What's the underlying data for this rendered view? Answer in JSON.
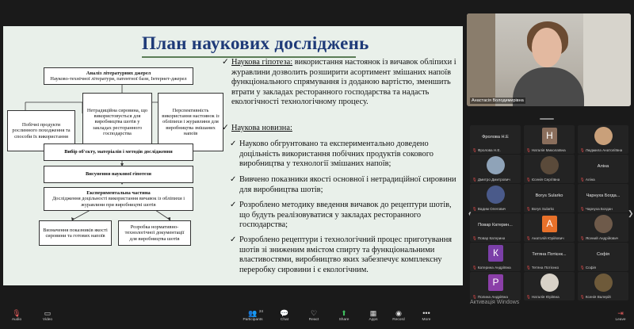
{
  "slide": {
    "title": "План наукових досліджень",
    "flow": {
      "box_top_title": "Аналіз літературних джерел",
      "box_top_sub": "Науково-технічної літератури, патентної бази, Інтернет-джерел",
      "box_l1": "Побічні продукти рослинного походження та способи їх використання",
      "box_l2": "Нетрадиційна сировина, що використовується для виробництва шотів у закладах ресторанного господарства",
      "box_l3": "Перспективність використання настоянок із обліпихи і журавлини для виробництва змішаних напоїв",
      "box_objects": "Вибір об'єкту, матеріалів і методів дослідження",
      "box_hypothesis": "Висунення наукової гіпотези",
      "box_exp_title": "Експериментальна частина",
      "box_exp_sub": "Дослідження доцільності використання вичавок із обліпихи і журавлини при виробництві шотів",
      "box_b1": "Визначення показників якості сировини та готових напоїв",
      "box_b2": "Розробка нормативно-технологічної документації для виробництва шотів"
    },
    "hypothesis_label": "Наукова гіпотеза:",
    "hypothesis_text": " використання настоянок із вичавок обліпихи і журавлини дозволить розширити асортимент змішаних напоїв функціонального спрямування із доданою вартістю, зменшить втрати у закладах ресторанного господарства та надасть екологічності технологічному процесу.",
    "novelty_label": "Наукова новизна:",
    "bullets": [
      "Науково обгрунтовано та експериментально доведено доцільність використання побічних продуктів сокового виробництва у технології змішаних напоїв;",
      "Вивчено показники якості основної і нетрадиційної сировини для виробництва шотів;",
      "Розроблено методику введення вичавок до рецептури шотів, що будуть реалізовуватися у закладах ресторанного господарства;",
      "Розроблено рецептури і технологічний процес приготування шотів зі зниженим вмістом спирту та функціональними властивостями, виробництво яких забезпечує комплексну переробку сировини і є екологічним."
    ]
  },
  "self_video": {
    "name": "Анастасія Володимирівна"
  },
  "gallery": {
    "tiles": [
      {
        "name": "Фролова Н.Е",
        "sub": "Фролова Н.Е.",
        "type": "text"
      },
      {
        "name": "",
        "sub": "Наталія Миколаївна",
        "type": "avatar",
        "letter": "Н",
        "color": "#8a6e5c"
      },
      {
        "name": "",
        "sub": "Людмила Анатоліївна",
        "type": "photo",
        "color": "#c9a07a"
      },
      {
        "name": "",
        "sub": "Дмитро Дмитрович",
        "type": "photo",
        "color": "#8fa3b8"
      },
      {
        "name": "",
        "sub": "Єсенія Сергіївна",
        "type": "photo",
        "color": "#5a4a3a"
      },
      {
        "name": "Аліна",
        "sub": "Аліна",
        "type": "text"
      },
      {
        "name": "",
        "sub": "Вадим Олегович",
        "type": "photo",
        "color": "#4a5a8a"
      },
      {
        "name": "Borys Sularko",
        "sub": "Borys Sularko",
        "type": "text"
      },
      {
        "name": "Чарнуха Богда...",
        "sub": "Чарнуха Богдан",
        "type": "text"
      },
      {
        "name": "Повар Катерин...",
        "sub": "Повар Катерина",
        "type": "text"
      },
      {
        "name": "",
        "sub": "Анатолій Юрійович",
        "type": "avatar",
        "letter": "А",
        "color": "#e8712a"
      },
      {
        "name": "",
        "sub": "Ясений Андрійович",
        "type": "photo",
        "color": "#6e5a4a"
      },
      {
        "name": "",
        "sub": "Катерина Андріївна",
        "type": "avatar",
        "letter": "К",
        "color": "#7b3fa8"
      },
      {
        "name": "Тетяна Потієнк...",
        "sub": "Тетяна Потієнко",
        "type": "text"
      },
      {
        "name": "Софія",
        "sub": "Софія",
        "type": "text"
      },
      {
        "name": "",
        "sub": "Полина Андріївна",
        "type": "avatar",
        "letter": "P",
        "color": "#8b3fa8"
      },
      {
        "name": "",
        "sub": "Наталія Юріївна",
        "type": "photo",
        "color": "#d8d2c8"
      },
      {
        "name": "",
        "sub": "Ксенія Валерій",
        "type": "photo",
        "color": "#6e5a3a"
      }
    ]
  },
  "watermark": {
    "line1": "Активація Windows",
    "line2": "Перейдіть до розділу \"Настройки\", щоб активувати Windows."
  },
  "toolbar": {
    "audio": "Audio",
    "video": "Video",
    "participants": "Participants",
    "participants_count": "24",
    "chat": "Chat",
    "react": "React",
    "share": "Share",
    "apps": "Apps",
    "record": "Record",
    "more": "More",
    "leave": "Leave"
  }
}
